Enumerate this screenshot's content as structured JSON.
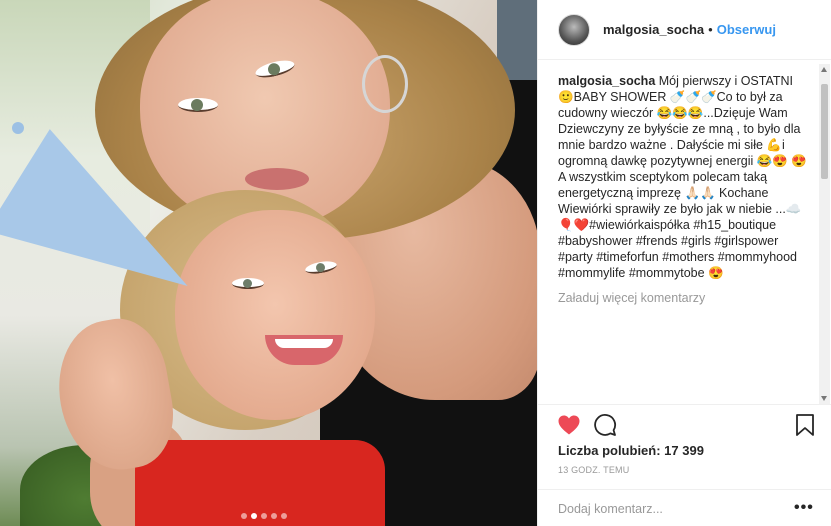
{
  "header": {
    "username": "malgosia_socha",
    "separator": "•",
    "follow_label": "Obserwuj"
  },
  "caption": {
    "username": "malgosia_socha",
    "text": "Mój pierwszy i OSTATNI 🙂BABY SHOWER 🍼🍼🍼Co to był za cudowny wieczór 😂😂😂...Dzięuje Wam Dziewczyny ze byłyście ze mną , to było dla mnie bardzo ważne . Dałyście mi siłe 💪i ogromną dawkę pozytywnej energii 😂😍 😍 A wszystkim sceptykom polecam taką energetyczną imprezę 🙏🏻🙏🏻 Kochane Wiewiórki sprawiły ze było jak w niebie ...☁️🎈❤️#wiewiórkaispółka #h15_boutique #babyshower #frends #girls #girlspower #party #timeforfun #mothers #mommyhood #mommylife #mommytobe 😍"
  },
  "load_more_label": "Załaduj więcej komentarzy",
  "likes_text": "Liczba polubień: 17 399",
  "time_text": "13 GODZ. TEMU",
  "comment_input": {
    "placeholder": "Dodaj komentarz..."
  },
  "more_label": "•••",
  "carousel": {
    "total": 5,
    "active_index": 1
  },
  "colors": {
    "like_red": "#ed4956",
    "follow_blue": "#3897f0",
    "muted_gray": "#999999"
  },
  "icons": [
    "heart-icon",
    "comment-icon",
    "bookmark-icon"
  ]
}
